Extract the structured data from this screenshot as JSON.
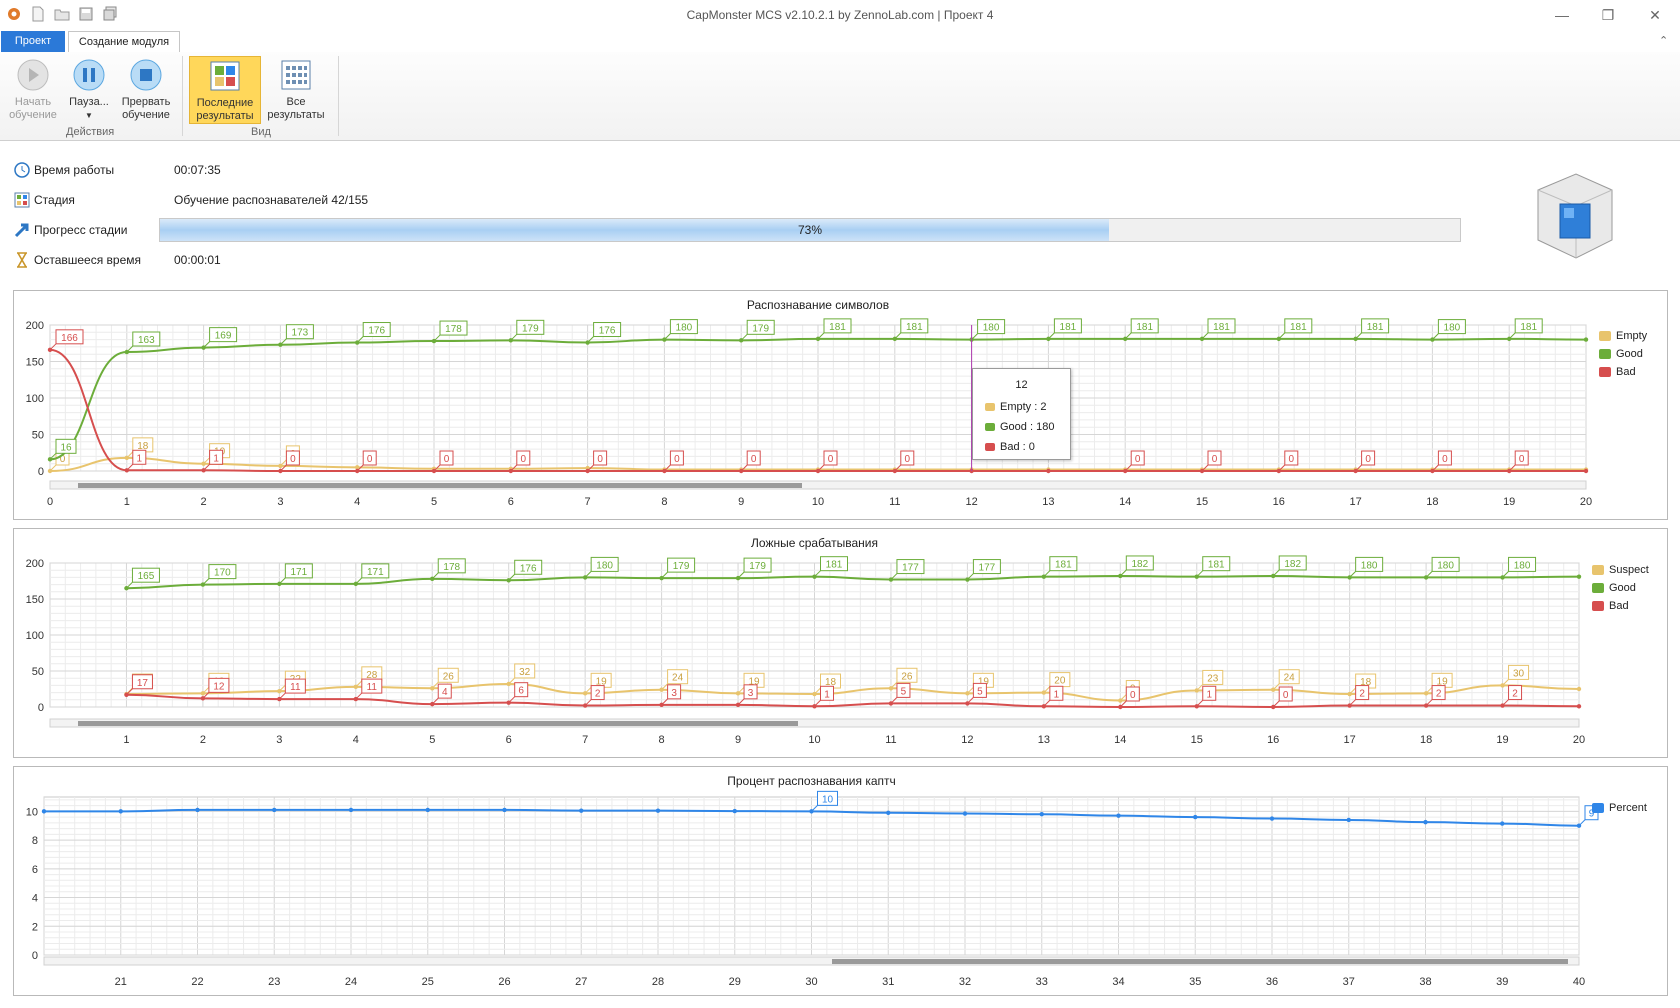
{
  "window": {
    "title": "CapMonster MCS v2.10.2.1 by ZennoLab.com | Проект 4"
  },
  "tabs": [
    {
      "label": "Проект"
    },
    {
      "label": "Создание модуля"
    }
  ],
  "ribbon": {
    "group_actions": "Действия",
    "group_view": "Вид",
    "start": "Начать\nобучение",
    "pause": "Пауза...",
    "stop": "Прервать\nобучение",
    "last": "Последние\nрезультаты",
    "all": "Все\nрезультаты"
  },
  "info": {
    "runtime_label": "Время работы",
    "runtime_value": "00:07:35",
    "stage_label": "Стадия",
    "stage_value": "Обучение распознавателей 42/155",
    "progress_label": "Прогресс стадии",
    "progress_value": 73,
    "progress_text": "73%",
    "remaining_label": "Оставшееся время",
    "remaining_value": "00:00:01"
  },
  "colors": {
    "empty": "#e8c46d",
    "good": "#6cad3a",
    "bad": "#d64e4e",
    "percent": "#2f86e8",
    "accent": "#2b79d8"
  },
  "tooltip": {
    "title": "12",
    "empty": "Empty : 2",
    "good": "Good : 180",
    "bad": "Bad : 0"
  },
  "chart_data": [
    {
      "type": "line",
      "title": "Распознавание символов",
      "x": [
        0,
        1,
        2,
        3,
        4,
        5,
        6,
        7,
        8,
        9,
        10,
        11,
        12,
        13,
        14,
        15,
        16,
        17,
        18,
        19,
        20
      ],
      "ylim": [
        0,
        200
      ],
      "yticks": [
        0,
        50,
        100,
        150,
        200
      ],
      "series": [
        {
          "name": "Empty",
          "values": [
            0,
            18,
            10,
            7,
            5,
            3,
            3,
            4,
            2,
            2,
            2,
            2,
            2,
            2,
            2,
            2,
            2,
            2,
            2,
            2,
            2
          ],
          "labels": [
            0,
            18,
            10,
            0,
            null,
            null,
            null,
            null,
            null,
            null,
            null,
            null,
            null,
            null,
            null,
            null,
            null,
            null,
            null,
            null,
            null
          ]
        },
        {
          "name": "Good",
          "values": [
            16,
            163,
            169,
            173,
            176,
            178,
            179,
            176,
            180,
            179,
            181,
            181,
            180,
            181,
            181,
            181,
            181,
            181,
            180,
            181,
            180
          ],
          "labels": [
            16,
            163,
            169,
            173,
            176,
            178,
            179,
            176,
            180,
            179,
            181,
            181,
            180,
            181,
            181,
            181,
            181,
            181,
            180,
            181,
            null
          ]
        },
        {
          "name": "Bad",
          "values": [
            166,
            1,
            1,
            0,
            0,
            0,
            0,
            0,
            0,
            0,
            0,
            0,
            0,
            0,
            0,
            0,
            0,
            0,
            0,
            0,
            0
          ],
          "labels": [
            166,
            1,
            1,
            0,
            0,
            0,
            0,
            0,
            0,
            0,
            0,
            0,
            null,
            null,
            0,
            0,
            0,
            0,
            0,
            0,
            null
          ]
        }
      ],
      "legend_position": "right"
    },
    {
      "type": "line",
      "title": "Ложные срабатывания",
      "x": [
        1,
        2,
        3,
        4,
        5,
        6,
        7,
        8,
        9,
        10,
        11,
        12,
        13,
        14,
        15,
        16,
        17,
        18,
        19,
        20
      ],
      "ylim": [
        0,
        200
      ],
      "yticks": [
        0,
        50,
        100,
        150,
        200
      ],
      "series": [
        {
          "name": "Suspect",
          "values": [
            18,
            19,
            22,
            28,
            26,
            32,
            19,
            24,
            19,
            18,
            26,
            19,
            20,
            9,
            23,
            24,
            18,
            19,
            30,
            25
          ],
          "labels": [
            17,
            18,
            22,
            28,
            26,
            32,
            19,
            24,
            19,
            18,
            26,
            19,
            20,
            9,
            23,
            24,
            18,
            19,
            30,
            null
          ]
        },
        {
          "name": "Good",
          "values": [
            165,
            170,
            171,
            171,
            178,
            176,
            180,
            179,
            179,
            181,
            177,
            177,
            181,
            182,
            181,
            182,
            180,
            180,
            180,
            181
          ],
          "labels": [
            165,
            170,
            171,
            171,
            178,
            176,
            180,
            179,
            179,
            181,
            177,
            177,
            181,
            182,
            181,
            182,
            180,
            180,
            180,
            null
          ]
        },
        {
          "name": "Bad",
          "values": [
            17,
            12,
            11,
            11,
            4,
            6,
            2,
            3,
            3,
            1,
            5,
            5,
            1,
            0,
            1,
            0,
            2,
            2,
            2,
            1
          ],
          "labels": [
            17,
            12,
            11,
            11,
            4,
            6,
            2,
            3,
            3,
            1,
            5,
            5,
            1,
            0,
            1,
            0,
            2,
            2,
            2,
            null
          ]
        }
      ],
      "legend_position": "right"
    },
    {
      "type": "line",
      "title": "Процент распознавания каптч",
      "x": [
        20,
        21,
        22,
        23,
        24,
        25,
        26,
        27,
        28,
        29,
        30,
        31,
        32,
        33,
        34,
        35,
        36,
        37,
        38,
        39,
        40
      ],
      "xticks": [
        21,
        22,
        23,
        24,
        25,
        26,
        27,
        28,
        29,
        30,
        31,
        32,
        33,
        34,
        35,
        36,
        37,
        38,
        39,
        40
      ],
      "ylim": [
        0,
        11
      ],
      "yticks": [
        0,
        2,
        4,
        6,
        8,
        10
      ],
      "series": [
        {
          "name": "Percent",
          "values": [
            10,
            10,
            10.1,
            10.1,
            10.1,
            10.1,
            10.1,
            10.05,
            10.05,
            10.02,
            10,
            9.9,
            9.85,
            9.8,
            9.7,
            9.6,
            9.5,
            9.4,
            9.25,
            9.15,
            9
          ],
          "labels": {
            "30": 10,
            "40": 9
          }
        }
      ],
      "legend_position": "right"
    }
  ]
}
